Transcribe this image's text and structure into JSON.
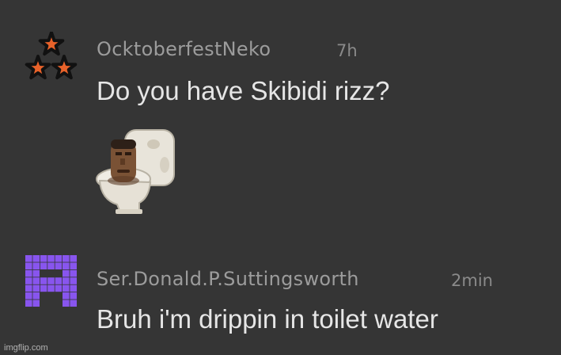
{
  "comments": [
    {
      "username": "OcktoberfestNeko",
      "time": "7h",
      "text": "Do you have Skibidi rizz?",
      "avatar_icon": "three-orange-stars-icon",
      "attachment_icon": "skibidi-toilet-icon"
    },
    {
      "username": "Ser.Donald.P.Suttingsworth",
      "time": "2min",
      "text": "Bruh i'm drippin in toilet water",
      "avatar_icon": "purple-pixel-h-icon"
    }
  ],
  "colors": {
    "background": "#353535",
    "username": "#9c9c9c",
    "text": "#e6e6e6",
    "star_fill": "#e8622a",
    "avatar_purple": "#8855ee"
  },
  "watermark": "imgflip.com"
}
